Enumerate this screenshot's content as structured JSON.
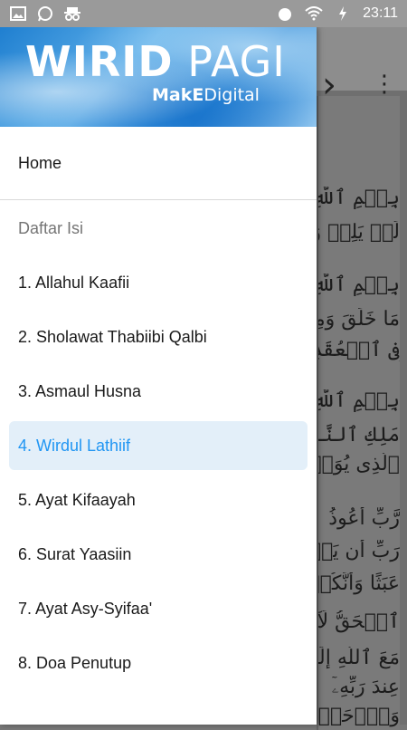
{
  "status_bar": {
    "time": "23:11",
    "left_icons": [
      "image-icon",
      "whatsapp-icon",
      "incognito-icon"
    ],
    "right_icons": [
      "alarm-icon",
      "wifi-icon",
      "battery-charging-icon"
    ]
  },
  "drawer": {
    "header": {
      "title_bold": "WIRID",
      "title_light": " PAGI",
      "subtitle_bold": "MakE",
      "subtitle_light": "Digital"
    },
    "home_label": "Home",
    "section_title": "Daftar Isi",
    "items": [
      {
        "label": "1. Allahul Kaafii",
        "active": false
      },
      {
        "label": "2. Sholawat Thabiibi Qalbi",
        "active": false
      },
      {
        "label": "3. Asmaul Husna",
        "active": false
      },
      {
        "label": "4. Wirdul Lathiif",
        "active": true
      },
      {
        "label": "5. Ayat Kifaayah",
        "active": false
      },
      {
        "label": "6. Surat Yaasiin",
        "active": false
      },
      {
        "label": "7. Ayat Asy-Syifaa'",
        "active": false
      },
      {
        "label": "8. Doa Penutup",
        "active": false
      }
    ]
  },
  "background": {
    "next_label": "›",
    "menu_label": "⋮",
    "lines": [
      "بِسۡمِ ٱللَّهِ ٱلرَّ",
      "لَمۡ يَلِدۡ وَلَمۡ",
      "بِسۡمِ ٱللَّهِ ٱلرَّ",
      "مَا خَلَقَ وَمِن",
      "فِى ٱلۡعُقَدِ",
      "بِسۡمِ ٱللَّهِ ٱلرَّ",
      "مَلِكِ ٱلنَّاسِ",
      "ٱلَّذِى يُوَسۡوِسُ",
      "رَّبِّ أَعُوذُ",
      "رَبِّ أَن يَحۡضُرُونِ",
      "عَبَثًا وَأَنَّكُمۡ",
      "ٱلۡحَقُّ لَآ إِلَٰهَ",
      "مَعَ ٱللَّهِ إِلَٰهًا",
      "عِندَ رَبِّهِۦٓ",
      "وَٱرۡحَمۡ وَأَنتَ"
    ]
  },
  "colors": {
    "accent": "#2196f3",
    "active_bg": "#e3eff9",
    "section_title": "#757575"
  }
}
